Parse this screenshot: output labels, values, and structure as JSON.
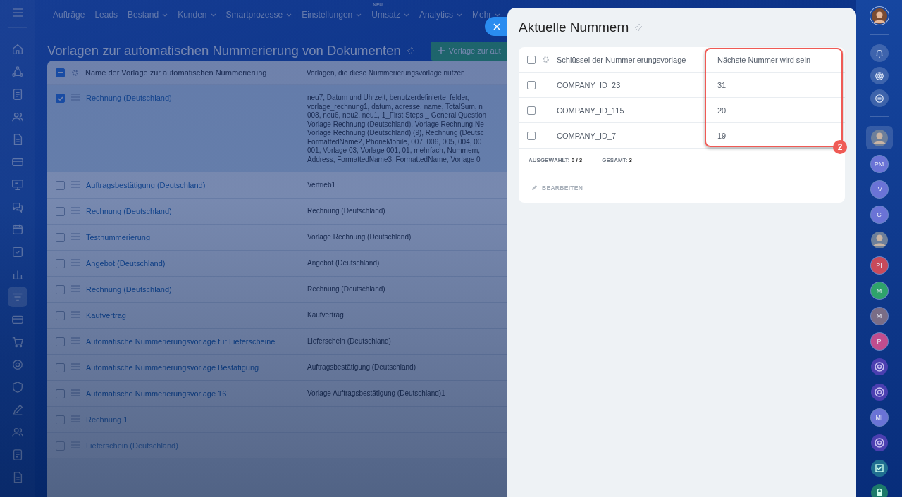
{
  "top_menu": [
    {
      "label": "Aufträge",
      "dropdown": false
    },
    {
      "label": "Leads",
      "dropdown": false
    },
    {
      "label": "Bestand",
      "dropdown": true
    },
    {
      "label": "Kunden",
      "dropdown": true
    },
    {
      "label": "Smartprozesse",
      "dropdown": true
    },
    {
      "label": "Einstellungen",
      "dropdown": true
    },
    {
      "label": "Umsatz",
      "dropdown": true,
      "badge": "NEU"
    },
    {
      "label": "Analytics",
      "dropdown": true
    },
    {
      "label": "Mehr",
      "dropdown": true
    }
  ],
  "left_nav": [
    {
      "kind": "home",
      "selected": false
    },
    {
      "kind": "nodes",
      "selected": false
    },
    {
      "kind": "doc",
      "selected": false
    },
    {
      "kind": "people",
      "selected": false
    },
    {
      "kind": "page",
      "selected": false
    },
    {
      "kind": "card",
      "selected": false
    },
    {
      "kind": "board",
      "selected": false
    },
    {
      "kind": "chat",
      "selected": false
    },
    {
      "kind": "calendar",
      "selected": false
    },
    {
      "kind": "check",
      "selected": false
    },
    {
      "kind": "chart",
      "selected": false
    },
    {
      "kind": "filter",
      "selected": true
    },
    {
      "kind": "card",
      "selected": false
    },
    {
      "kind": "cart",
      "selected": false
    },
    {
      "kind": "target",
      "selected": false
    },
    {
      "kind": "shield",
      "selected": false
    },
    {
      "kind": "pen",
      "selected": false
    },
    {
      "kind": "people",
      "selected": false
    },
    {
      "kind": "doc",
      "selected": false
    },
    {
      "kind": "page",
      "selected": false
    }
  ],
  "page": {
    "title": "Vorlagen zur automatischen Nummerierung von Dokumenten",
    "add_button": "Vorlage zur aut",
    "table": {
      "columns": [
        "Name der Vorlage zur automatischen Nummerierung",
        "Vorlagen, die diese Nummerierungsvorlage nutzen"
      ],
      "header_partial": true,
      "rows": [
        {
          "checked": true,
          "name": "Rechnung (Deutschland)",
          "templates": [
            "neu7, Datum und Uhrzeit, benutzerdefinierte_felder,",
            "vorlage_rechnung1, datum, adresse, name, TotalSum, n",
            "008, neu6, neu2, neu1, 1_First Steps _ General Question",
            "Vorlage Rechnung (Deutschland), Vorlage Rechnung Ne",
            "Vorlage Rechnung (Deutschland) (9), Rechnung (Deutsc",
            "FormattedName2, PhoneMobile, 007, 006, 005, 004, 00",
            "001, Vorlage 03, Vorlage 001, 01, mehrfach, Nummern,",
            "Address, FormattedName3, FormattedName, Vorlage 0"
          ]
        },
        {
          "checked": false,
          "name": "Auftragsbestätigung (Deutschland)",
          "templates": [
            "Vertrieb1"
          ]
        },
        {
          "checked": false,
          "name": "Rechnung (Deutschland)",
          "templates": [
            "Rechnung (Deutschland)"
          ]
        },
        {
          "checked": false,
          "name": "Testnummerierung",
          "templates": [
            "Vorlage Rechnung (Deutschland)"
          ]
        },
        {
          "checked": false,
          "name": "Angebot (Deutschland)",
          "templates": [
            "Angebot (Deutschland)"
          ]
        },
        {
          "checked": false,
          "name": "Rechnung (Deutschland)",
          "templates": [
            "Rechnung (Deutschland)"
          ]
        },
        {
          "checked": false,
          "name": "Kaufvertrag",
          "templates": [
            "Kaufvertrag"
          ]
        },
        {
          "checked": false,
          "name": "Automatische Nummerierungsvorlage für Lieferscheine",
          "templates": [
            "Lieferschein (Deutschland)"
          ]
        },
        {
          "checked": false,
          "name": "Automatische Nummerierungsvorlage Bestätigung",
          "templates": [
            "Auftragsbestätigung (Deutschland)"
          ]
        },
        {
          "checked": false,
          "name": "Automatische Nummerierungsvorlage 16",
          "templates": [
            "Vorlage Auftragsbestätigung (Deutschland)1"
          ]
        },
        {
          "checked": false,
          "name": "Rechnung 1",
          "templates": []
        },
        {
          "checked": false,
          "name": "Lieferschein (Deutschland)",
          "templates": []
        }
      ]
    }
  },
  "panel": {
    "title": "Aktuelle Nummern",
    "table": {
      "columns": [
        "Schlüssel der Nummerierungsvorlage",
        "Nächste Nummer wird sein"
      ],
      "header_checked": false,
      "rows": [
        {
          "checked": false,
          "key": "COMPANY_ID_23",
          "next": "31"
        },
        {
          "checked": false,
          "key": "COMPANY_ID_115",
          "next": "20"
        },
        {
          "checked": false,
          "key": "COMPANY_ID_7",
          "next": "19"
        }
      ],
      "selected_label": "AUSGEWÄHLT:",
      "selected_value": "0 / 3",
      "total_label": "GESAMT:",
      "total_value": "3",
      "edit_button": "BEARBEITEN"
    },
    "annotation": {
      "badge": "2"
    }
  },
  "right_bar": {
    "tools": [
      {
        "kind": "bell"
      },
      {
        "kind": "swirl"
      },
      {
        "kind": "chat"
      }
    ],
    "contacts": [
      {
        "kind": "avatar",
        "selected": true
      },
      {
        "kind": "initials",
        "label": "PM",
        "color": "#6a73d6",
        "selected": false
      },
      {
        "kind": "initials",
        "label": "IV",
        "color": "#6a73d6",
        "selected": false
      },
      {
        "kind": "initials",
        "label": "C",
        "color": "#6a73d6",
        "selected": false
      },
      {
        "kind": "avatar",
        "selected": false
      },
      {
        "kind": "initials",
        "label": "PI",
        "color": "#c94a5a",
        "selected": false
      },
      {
        "kind": "initials",
        "label": "M",
        "color": "#2fa36b",
        "selected": false
      },
      {
        "kind": "initials",
        "label": "M",
        "color": "#7a6d86",
        "selected": false
      },
      {
        "kind": "initials",
        "label": "P",
        "color": "#c04d8e",
        "selected": false
      },
      {
        "kind": "logo",
        "selected": false
      },
      {
        "kind": "logo",
        "selected": false
      },
      {
        "kind": "initials",
        "label": "MI",
        "color": "#6a73d6",
        "selected": false
      },
      {
        "kind": "logo",
        "selected": false
      },
      {
        "kind": "check",
        "selected": false
      },
      {
        "kind": "lock",
        "selected": false
      }
    ]
  }
}
